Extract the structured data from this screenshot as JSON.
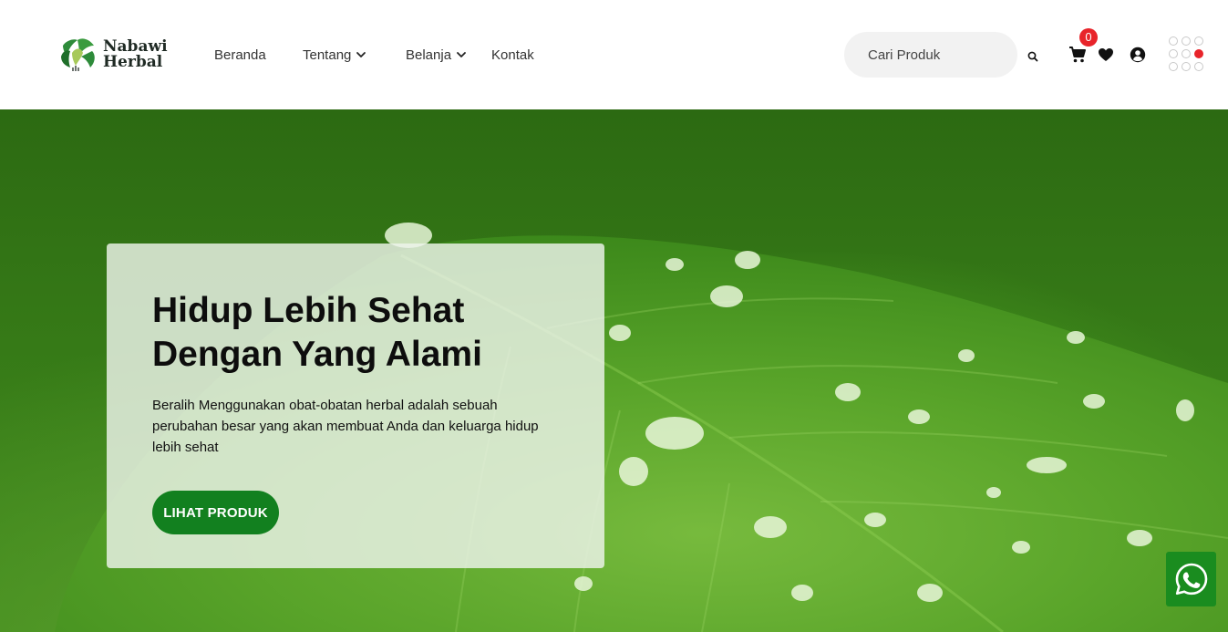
{
  "brand": {
    "line1": "Nabawi",
    "line2": "Herbal"
  },
  "nav": {
    "items": [
      {
        "label": "Beranda",
        "has_dropdown": false
      },
      {
        "label": "Tentang",
        "has_dropdown": true
      },
      {
        "label": "Belanja",
        "has_dropdown": true
      },
      {
        "label": "Kontak",
        "has_dropdown": false
      }
    ]
  },
  "search": {
    "placeholder": "Cari Produk"
  },
  "cart": {
    "count": "0"
  },
  "icons": {
    "search": "search-icon",
    "cart": "cart-icon",
    "wishlist": "heart-icon",
    "account": "user-circle-icon",
    "menu": "grid-dots-icon",
    "whatsapp": "whatsapp-icon"
  },
  "hero": {
    "title_line1": "Hidup Lebih Sehat",
    "title_line2": "Dengan Yang Alami",
    "text": "Beralih Menggunakan obat-obatan herbal adalah sebuah perubahan besar yang akan membuat Anda dan keluarga hidup lebih sehat",
    "button": "LIHAT PRODUK"
  },
  "colors": {
    "accent_green": "#12801f",
    "badge_red": "#e8242a",
    "whatsapp_green": "#1a8c1f"
  }
}
